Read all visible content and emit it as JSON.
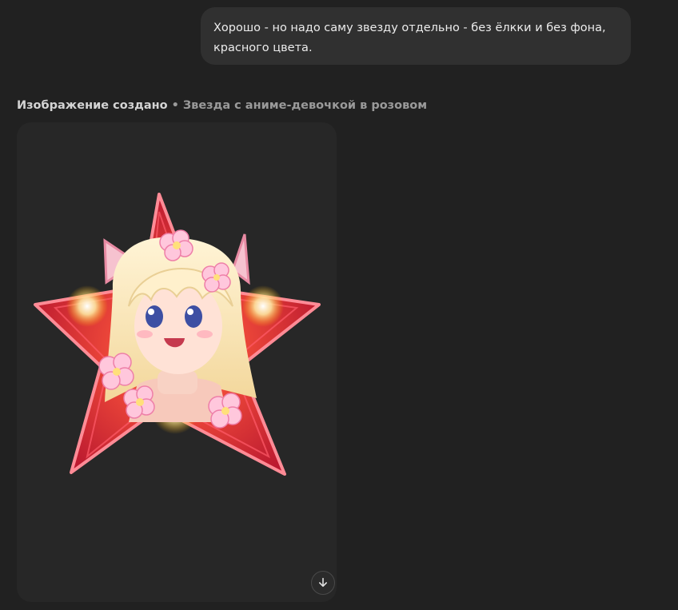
{
  "chat": {
    "user_message": "Хорошо - но надо саму звезду отдельно - без ёлкки и без фона, красного цвета."
  },
  "generation": {
    "status": "Изображение создано",
    "separator": "•",
    "title": "Звезда с аниме-девочкой в розовом"
  },
  "icons": {
    "download": "download-arrow-icon"
  },
  "colors": {
    "background": "#212121",
    "bubble": "#303030",
    "card": "#272727",
    "star_red": "#d8263a"
  }
}
